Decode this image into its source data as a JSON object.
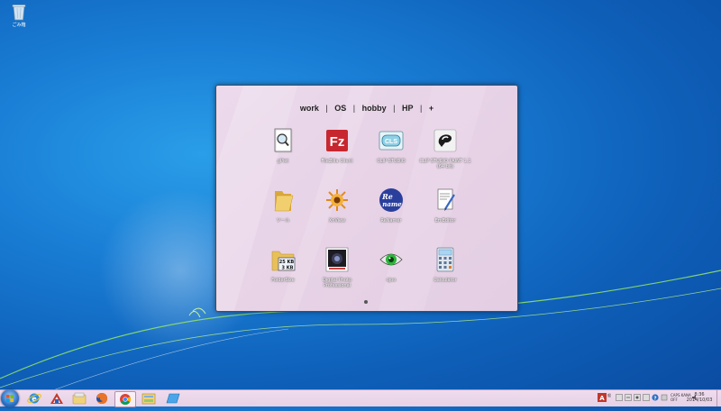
{
  "desktop": {
    "icons": [
      {
        "label": "ごみ箱",
        "icon": "recycle-bin-icon"
      }
    ]
  },
  "launcher": {
    "tabs": [
      {
        "label": "work",
        "active": true
      },
      {
        "label": "OS"
      },
      {
        "label": "hobby"
      },
      {
        "label": "HP"
      },
      {
        "label": "+"
      }
    ],
    "separator": "|",
    "apps": [
      {
        "label": "gPiet",
        "icon": "document-magnifier-icon"
      },
      {
        "label": "FileZilla Client",
        "icon": "filezilla-icon"
      },
      {
        "label": "CLIP STUDIO",
        "icon": "clip-studio-icon"
      },
      {
        "label": "CLIP STUDIO PAINT 1.1 (64 bit)",
        "icon": "clip-studio-paint-icon"
      },
      {
        "label": "ツール",
        "icon": "folder-icon"
      },
      {
        "label": "XnView",
        "icon": "xnview-icon"
      },
      {
        "label": "ReNamer",
        "icon": "renamer-icon"
      },
      {
        "label": "EmEditor",
        "icon": "emeditor-icon"
      },
      {
        "label": "FolderSize",
        "icon": "foldersize-icon"
      },
      {
        "label": "Digital Photo Professional",
        "icon": "digital-photo-professional-icon"
      },
      {
        "label": "ojoo",
        "icon": "eye-icon"
      },
      {
        "label": "Calculator",
        "icon": "calculator-icon"
      }
    ],
    "foldersize_text": [
      "25 KB",
      "3 KB"
    ],
    "renamer_text": [
      "Re",
      "name"
    ],
    "page_count": 1,
    "current_page": 1
  },
  "taskbar": {
    "pinned": [
      {
        "name": "internet-explorer-icon"
      },
      {
        "name": "app-launcher-icon"
      },
      {
        "name": "explorer-icon"
      },
      {
        "name": "firefox-icon"
      },
      {
        "name": "chrome-icon",
        "active": true
      },
      {
        "name": "folder-app-icon"
      },
      {
        "name": "desktop-app-icon"
      }
    ],
    "tray": {
      "lang_top": "CAPS KANA",
      "lang_bottom": "OFF",
      "time": "8:36",
      "date": "2014/10/03"
    }
  },
  "colors": {
    "desktop_blue": "#1a7fd6",
    "launcher_bg": "#e7d2e6",
    "taskbar_bg": "#e6d0e5"
  }
}
